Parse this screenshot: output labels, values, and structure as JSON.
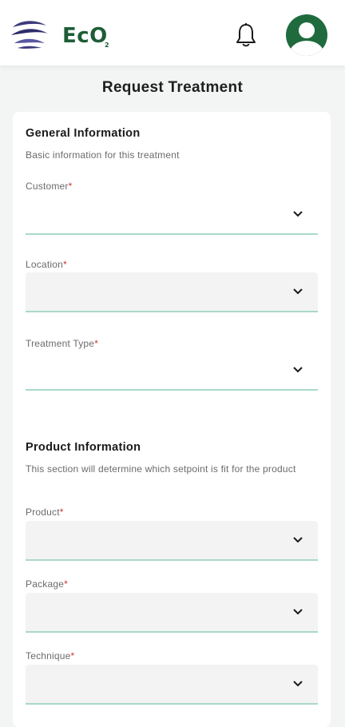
{
  "header": {
    "brand_text": "EcO",
    "brand_subscript": "2",
    "bell_icon": "bell-icon",
    "avatar_icon": "user-avatar-icon",
    "colors": {
      "brand": "#1f5d36",
      "logo_swoosh": "#3d3a7c",
      "accent_underline": "#a9d9c8",
      "required": "#d0342c"
    }
  },
  "page": {
    "title": "Request Treatment"
  },
  "general": {
    "title": "General Information",
    "subtitle": "Basic information for this treatment",
    "fields": [
      {
        "label": "Customer",
        "required_mark": "*",
        "value": ""
      },
      {
        "label": "Location",
        "required_mark": "*",
        "value": ""
      },
      {
        "label": "Treatment Type",
        "required_mark": "*",
        "value": ""
      }
    ]
  },
  "product": {
    "title": "Product Information",
    "subtitle": "This section will determine which setpoint is fit for the product",
    "fields": [
      {
        "label": "Product",
        "required_mark": "*",
        "value": ""
      },
      {
        "label": "Package",
        "required_mark": "*",
        "value": ""
      },
      {
        "label": "Technique",
        "required_mark": "*",
        "value": ""
      }
    ]
  }
}
